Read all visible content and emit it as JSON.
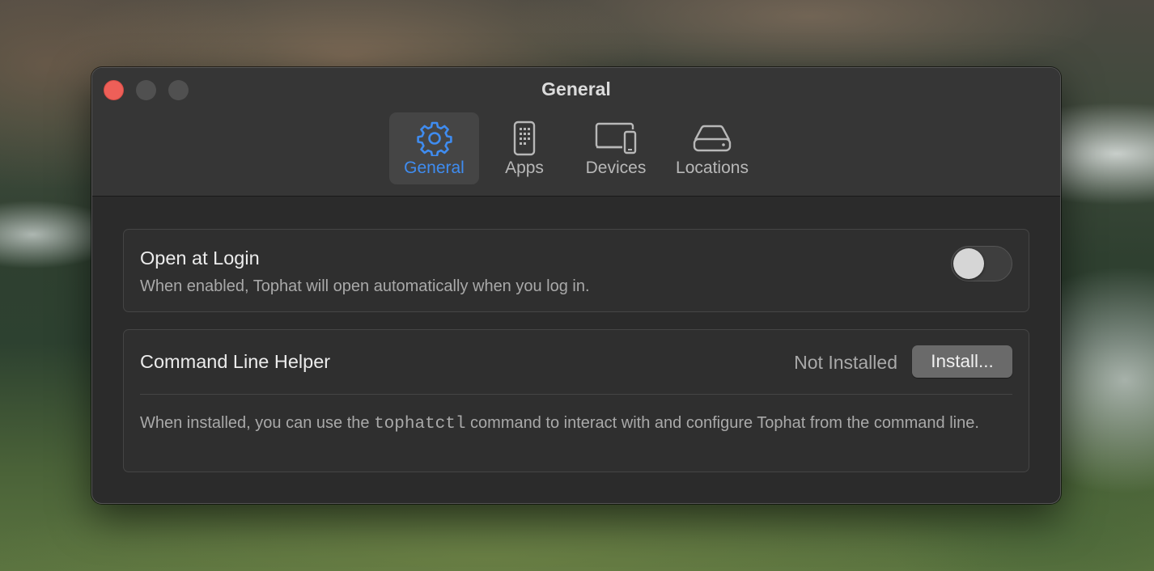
{
  "window": {
    "title": "General"
  },
  "toolbar": {
    "tabs": [
      {
        "label": "General",
        "icon": "gear-icon",
        "active": true
      },
      {
        "label": "Apps",
        "icon": "phone-icon",
        "active": false
      },
      {
        "label": "Devices",
        "icon": "devices-icon",
        "active": false
      },
      {
        "label": "Locations",
        "icon": "drive-icon",
        "active": false
      }
    ]
  },
  "settings": {
    "open_at_login": {
      "title": "Open at Login",
      "description": "When enabled, Tophat will open automatically when you log in.",
      "enabled": false
    },
    "cli_helper": {
      "title": "Command Line Helper",
      "status": "Not Installed",
      "button_label": "Install...",
      "description_before": "When installed, you can use the ",
      "command": "tophatctl",
      "description_after": " command to interact with and configure Tophat from the command line."
    }
  },
  "colors": {
    "accent": "#3f8cf0",
    "close_button": "#ee5f58",
    "window_bg": "#2b2b2b",
    "titlebar_bg": "#363636"
  }
}
